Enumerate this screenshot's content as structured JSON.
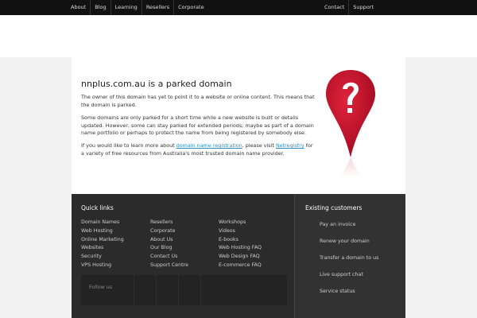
{
  "nav": {
    "left": [
      "About",
      "Blog",
      "Learning",
      "Resellers",
      "Corporate"
    ],
    "right": [
      "Contact",
      "Support"
    ]
  },
  "main": {
    "title": "nnplus.com.au is a parked domain",
    "p1": "The owner of this domain has yet to point it to a website or online content. This means that the domain is parked.",
    "p2": "Some domains are only parked for a short time while a new website is built or details updated. However, some can stay parked for extended periods; maybe as part of a domain name portfolio or perhaps to protect the name from being registered by somebody else.",
    "p3_before": "If you would like to learn more about ",
    "p3_link1": "domain name registration",
    "p3_middle": ", please visit ",
    "p3_link2": "Netregistry",
    "p3_after": " for a variety of free resources from Australia's most trusted domain name provider."
  },
  "footer": {
    "quick_links_title": "Quick links",
    "col1": [
      "Domain Names",
      "Web Hosting",
      "Online Marketing",
      "Websites",
      "Security",
      "VPS Hosting"
    ],
    "col2": [
      "Resellers",
      "Corporate",
      "About Us",
      "Our Blog",
      "Contact Us",
      "Support Centre"
    ],
    "col3": [
      "Workshops",
      "Videos",
      "E-books",
      "Web Hosting FAQ",
      "Web Design FAQ",
      "E-commerce FAQ"
    ],
    "follow_us": "Follow us",
    "existing_title": "Existing customers",
    "existing_items": [
      "Pay an invoice",
      "Renew your domain",
      "Transfer a domain to us",
      "Live support chat",
      "Service status"
    ]
  },
  "colors": {
    "accent_link": "#2a8fbd",
    "pin_red": "#c8102e",
    "topbar": "#111111",
    "footer": "#2b2b2b"
  },
  "icons": {
    "pin": "question-mark-pin-icon"
  }
}
